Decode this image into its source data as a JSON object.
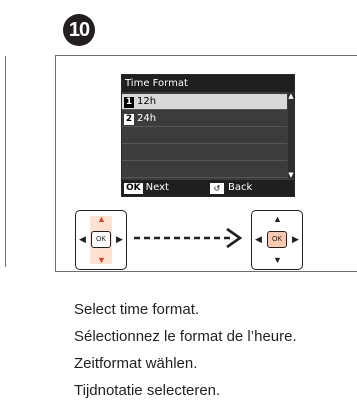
{
  "step": {
    "number": "10"
  },
  "lcd": {
    "title": "Time Format",
    "items": [
      {
        "num": "1",
        "label": "12h"
      },
      {
        "num": "2",
        "label": "24h"
      }
    ],
    "footer": {
      "ok_key": "OK",
      "next_label": "Next",
      "back_label": "Back"
    }
  },
  "instructions": [
    "Select time format.",
    "Sélectionnez le format de l’heure.",
    "Zeitformat wählen.",
    "Tijdnotatie selecteren."
  ],
  "pad": {
    "ok_label": "OK"
  },
  "colors": {
    "highlight": "#e0442e",
    "pad_fill": "#fde3cf",
    "ok_highlight": "#fbc9b0"
  }
}
